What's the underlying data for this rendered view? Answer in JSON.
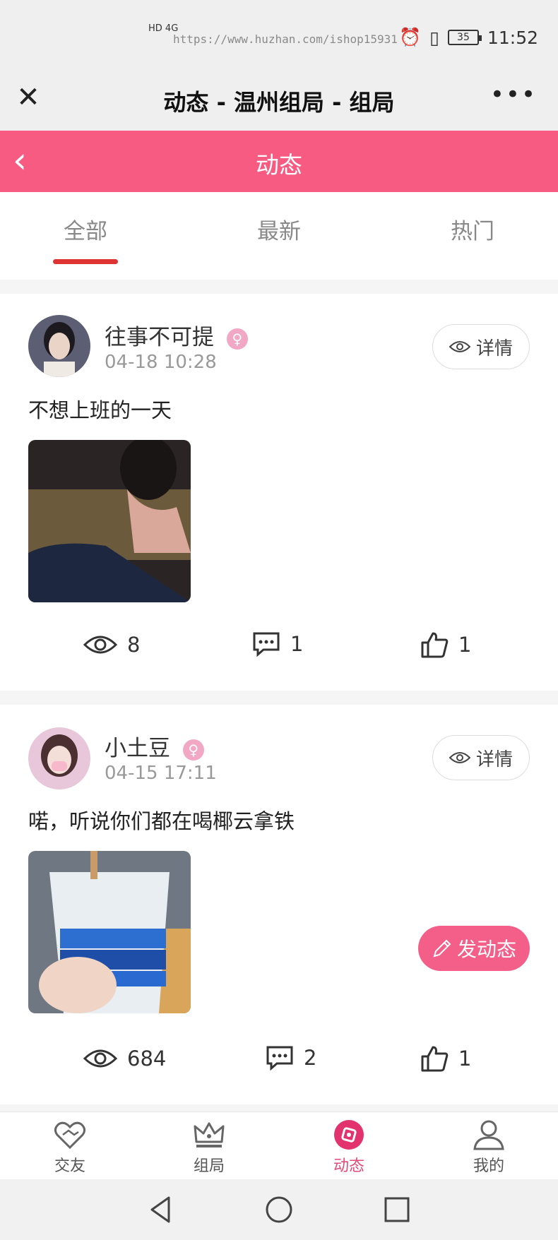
{
  "status_bar": {
    "url_watermark": "https://www.huzhan.com/ishop15931",
    "signal_text": "HD 4G",
    "battery": "35",
    "time": "11:52"
  },
  "title_bar": {
    "title": "动态 - 温州组局 - 组局"
  },
  "header": {
    "title": "动态",
    "accent_color": "#f75b82"
  },
  "tabs": [
    {
      "label": "全部",
      "active": true
    },
    {
      "label": "最新",
      "active": false
    },
    {
      "label": "热门",
      "active": false
    }
  ],
  "posts": [
    {
      "username": "往事不可提",
      "gender_icon": "female-icon",
      "time": "04-18 10:28",
      "detail_label": "详情",
      "text": "不想上班的一天",
      "views": "8",
      "comments": "1",
      "likes": "1"
    },
    {
      "username": "小土豆",
      "gender_icon": "female-icon",
      "time": "04-15 17:11",
      "detail_label": "详情",
      "text": "喏，听说你们都在喝椰云拿铁",
      "views": "684",
      "comments": "2",
      "likes": "1"
    }
  ],
  "fab": {
    "label": "发动态"
  },
  "bottom_nav": [
    {
      "label": "交友",
      "icon": "heart-handshake-icon",
      "active": false
    },
    {
      "label": "组局",
      "icon": "crown-icon",
      "active": false
    },
    {
      "label": "动态",
      "icon": "compass-icon",
      "active": true
    },
    {
      "label": "我的",
      "icon": "person-icon",
      "active": false
    }
  ]
}
